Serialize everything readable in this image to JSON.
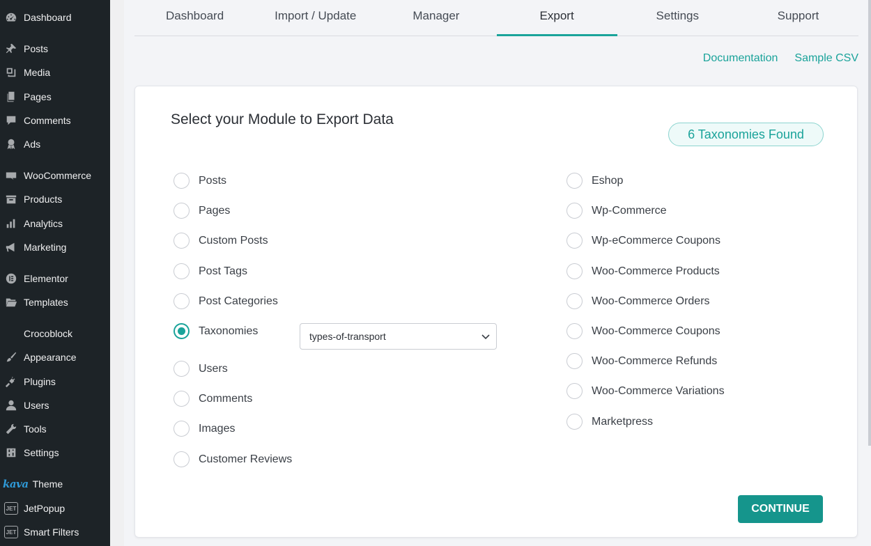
{
  "sidebar": {
    "items": [
      {
        "label": "Dashboard",
        "icon": "dashboard-icon"
      },
      {
        "label": "Posts",
        "icon": "pin-icon"
      },
      {
        "label": "Media",
        "icon": "media-icon"
      },
      {
        "label": "Pages",
        "icon": "pages-icon"
      },
      {
        "label": "Comments",
        "icon": "comments-icon"
      },
      {
        "label": "Ads",
        "icon": "award-icon"
      },
      {
        "label": "WooCommerce",
        "icon": "woo-icon"
      },
      {
        "label": "Products",
        "icon": "archive-icon"
      },
      {
        "label": "Analytics",
        "icon": "bar-chart-icon"
      },
      {
        "label": "Marketing",
        "icon": "megaphone-icon"
      },
      {
        "label": "Elementor",
        "icon": "elementor-icon"
      },
      {
        "label": "Templates",
        "icon": "folder-icon"
      },
      {
        "label": "Crocoblock",
        "icon": "crocoblock-icon"
      },
      {
        "label": "Appearance",
        "icon": "brush-icon"
      },
      {
        "label": "Plugins",
        "icon": "plug-icon"
      },
      {
        "label": "Users",
        "icon": "user-icon"
      },
      {
        "label": "Tools",
        "icon": "wrench-icon"
      },
      {
        "label": "Settings",
        "icon": "sliders-icon"
      },
      {
        "label": "Theme",
        "icon": "kava-logo",
        "logo_text": "kava"
      },
      {
        "label": "JetPopup",
        "icon": "jet-icon",
        "logo_text": "JET"
      },
      {
        "label": "Smart Filters",
        "icon": "jet-icon",
        "logo_text": "JET"
      }
    ]
  },
  "tabs": [
    {
      "label": "Dashboard",
      "active": false
    },
    {
      "label": "Import / Update",
      "active": false
    },
    {
      "label": "Manager",
      "active": false
    },
    {
      "label": "Export",
      "active": true
    },
    {
      "label": "Settings",
      "active": false
    },
    {
      "label": "Support",
      "active": false
    }
  ],
  "links": {
    "documentation": "Documentation",
    "sample_csv": "Sample CSV"
  },
  "card": {
    "title": "Select your Module to Export Data",
    "badge": "6 Taxonomies Found",
    "left_options": [
      {
        "label": "Posts",
        "checked": false
      },
      {
        "label": "Pages",
        "checked": false
      },
      {
        "label": "Custom Posts",
        "checked": false
      },
      {
        "label": "Post Tags",
        "checked": false
      },
      {
        "label": "Post Categories",
        "checked": false
      },
      {
        "label": "Taxonomies",
        "checked": true
      },
      {
        "label": "Users",
        "checked": false
      },
      {
        "label": "Comments",
        "checked": false
      },
      {
        "label": "Images",
        "checked": false
      },
      {
        "label": "Customer Reviews",
        "checked": false
      }
    ],
    "right_options": [
      {
        "label": "Eshop",
        "checked": false
      },
      {
        "label": "Wp-Commerce",
        "checked": false
      },
      {
        "label": "Wp-eCommerce Coupons",
        "checked": false
      },
      {
        "label": "Woo-Commerce Products",
        "checked": false
      },
      {
        "label": "Woo-Commerce Orders",
        "checked": false
      },
      {
        "label": "Woo-Commerce Coupons",
        "checked": false
      },
      {
        "label": "Woo-Commerce Refunds",
        "checked": false
      },
      {
        "label": "Woo-Commerce Variations",
        "checked": false
      },
      {
        "label": "Marketpress",
        "checked": false
      }
    ],
    "taxonomy_select": {
      "value": "types-of-transport"
    },
    "continue_label": "CONTINUE"
  },
  "colors": {
    "accent": "#1aa39a",
    "sidebar_bg": "#1d2327",
    "button": "#15958c"
  }
}
